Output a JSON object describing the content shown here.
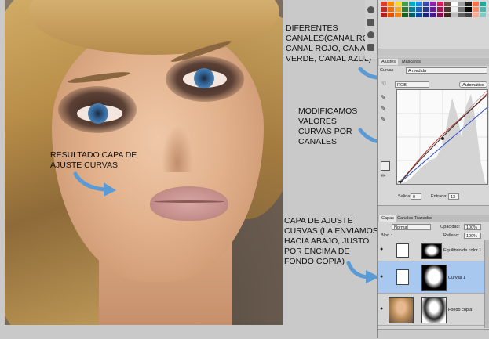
{
  "annotations": {
    "channels": "DIFERENTES CANALES(CANAL RGB, CANAL ROJO, CANAL VERDE, CANAL AZUL)",
    "curves": "MODIFICAMOS VALORES CURVAS POR CANALES",
    "result": "RESULTADO CAPA DE AJUSTE CURVAS",
    "layer": "CAPA DE AJUSTE CURVAS (LA ENVIAMOS HACIA ABAJO, JUSTO POR ENCIMA DE FONDO COPIA)"
  },
  "adjustments_panel": {
    "tabs": [
      "Ajustes",
      "Máscaras"
    ],
    "preset_label": "Curvas",
    "preset_value": "A medida",
    "channel_value": "RGB",
    "auto_button": "Automático",
    "input_label": "Salida:",
    "input_value": "0",
    "output_label": "Entrada:",
    "output_value": "13"
  },
  "layers_panel": {
    "tabs": [
      "Capas",
      "Canales",
      "Trazados"
    ],
    "blend_mode": "Normal",
    "opacity_label": "Opacidad:",
    "opacity_value": "100%",
    "lock_label": "Bloq.:",
    "fill_label": "Relleno:",
    "fill_value": "100%",
    "layers": [
      {
        "name": "Equilibrio de color 1"
      },
      {
        "name": "Curvas 1"
      },
      {
        "name": "Fondo copia"
      }
    ]
  },
  "colors": {
    "arrow": "#5b9bd5",
    "selected_layer": "#a9c8f0",
    "red_curve": "#c0392b",
    "blue_curve": "#2c4bd1"
  },
  "swatch_colors": [
    "#e53935",
    "#fb8c00",
    "#fdd835",
    "#43a047",
    "#00acc1",
    "#1e88e5",
    "#3949ab",
    "#8e24aa",
    "#d81b60",
    "#6d4c41",
    "#ffffff",
    "#9e9e9e",
    "#212121",
    "#ff7043",
    "#26a69a",
    "#c62828",
    "#ef6c00",
    "#f9a825",
    "#2e7d32",
    "#00838f",
    "#1565c0",
    "#283593",
    "#6a1b9a",
    "#ad1457",
    "#4e342e",
    "#eeeeee",
    "#757575",
    "#000000",
    "#ff8a65",
    "#4db6ac",
    "#b71c1c",
    "#e65100",
    "#f57f17",
    "#1b5e20",
    "#006064",
    "#0d47a1",
    "#1a237e",
    "#4a148c",
    "#880e4f",
    "#3e2723",
    "#bdbdbd",
    "#616161",
    "#424242",
    "#ffab91",
    "#80cbc4"
  ]
}
